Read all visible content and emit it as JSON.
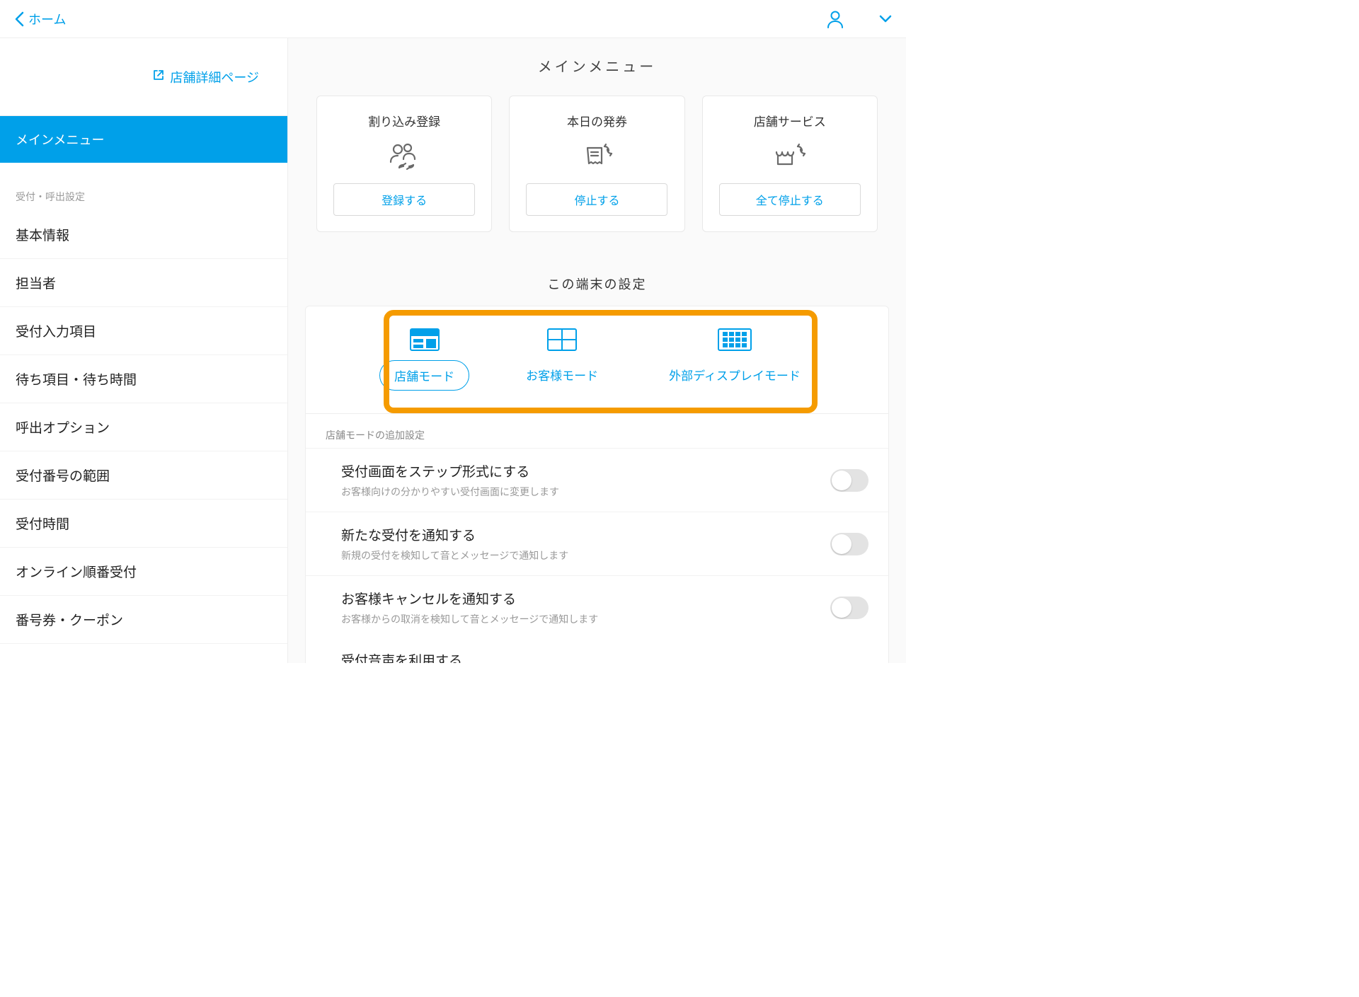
{
  "header": {
    "back_label": "ホーム"
  },
  "sidebar": {
    "store_link": "店舗詳細ページ",
    "active": "メインメニュー",
    "section_label": "受付・呼出設定",
    "items": [
      "基本情報",
      "担当者",
      "受付入力項目",
      "待ち項目・待ち時間",
      "呼出オプション",
      "受付番号の範囲",
      "受付時間",
      "オンライン順番受付",
      "番号券・クーポン"
    ]
  },
  "main": {
    "title": "メインメニュー",
    "cards": [
      {
        "title": "割り込み登録",
        "button": "登録する"
      },
      {
        "title": "本日の発券",
        "button": "停止する"
      },
      {
        "title": "店舗サービス",
        "button": "全て停止する"
      }
    ],
    "device_title": "この端末の設定",
    "modes": [
      {
        "label": "店舗モード"
      },
      {
        "label": "お客様モード"
      },
      {
        "label": "外部ディスプレイモード"
      }
    ],
    "sub_label": "店舗モードの追加設定",
    "settings": [
      {
        "title": "受付画面をステップ形式にする",
        "desc": "お客様向けの分かりやすい受付画面に変更します"
      },
      {
        "title": "新たな受付を通知する",
        "desc": "新規の受付を検知して音とメッセージで通知します"
      },
      {
        "title": "お客様キャンセルを通知する",
        "desc": "お客様からの取消を検知して音とメッセージで通知します"
      }
    ],
    "cutoff_title": "受付音声を利用する"
  }
}
